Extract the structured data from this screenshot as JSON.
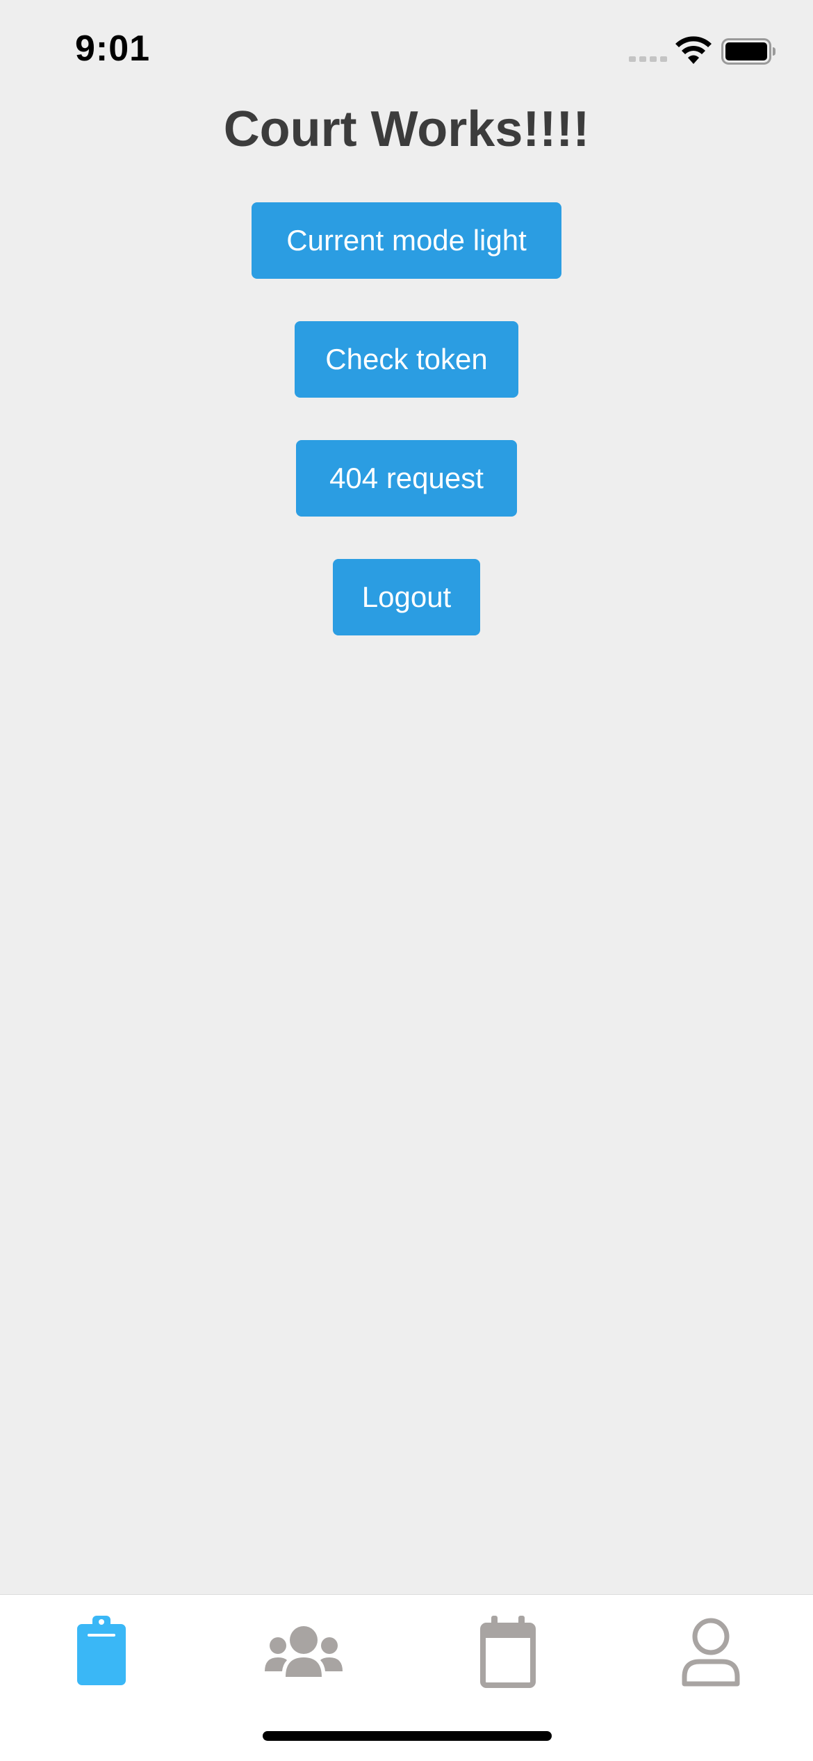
{
  "status_bar": {
    "time": "9:01"
  },
  "main": {
    "title": "Court Works!!!!",
    "buttons": [
      {
        "label": "Current mode light"
      },
      {
        "label": "Check token"
      },
      {
        "label": "404 request"
      },
      {
        "label": "Logout"
      }
    ]
  },
  "tab_bar": {
    "tabs": [
      {
        "icon": "clipboard-icon",
        "active": true
      },
      {
        "icon": "users-icon",
        "active": false
      },
      {
        "icon": "calendar-icon",
        "active": false
      },
      {
        "icon": "user-icon",
        "active": false
      }
    ]
  },
  "colors": {
    "background": "#eeeeee",
    "button": "#2b9de2",
    "title_text": "#3c3c3c",
    "tab_active": "#3ab7f6",
    "tab_inactive": "#a8a4a2"
  }
}
